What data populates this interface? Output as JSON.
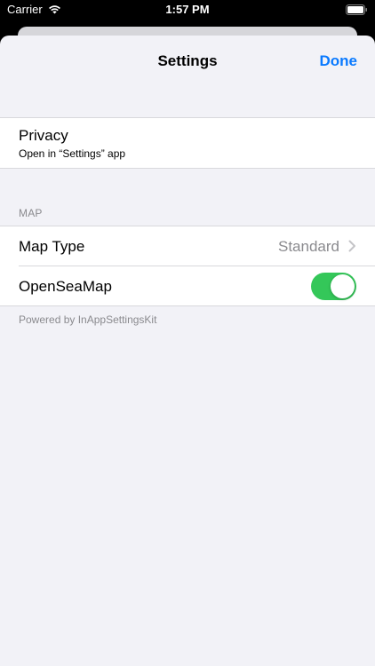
{
  "status_bar": {
    "carrier": "Carrier",
    "time": "1:57 PM",
    "wifi_icon": "wifi-icon",
    "battery_icon": "battery-icon"
  },
  "nav": {
    "title": "Settings",
    "done_label": "Done"
  },
  "privacy": {
    "title": "Privacy",
    "subtitle": "Open in “Settings” app"
  },
  "map_section": {
    "header": "MAP",
    "map_type": {
      "label": "Map Type",
      "value": "Standard",
      "icon": "chevron-right-icon"
    },
    "openseamap": {
      "label": "OpenSeaMap",
      "enabled": true
    }
  },
  "footer": {
    "text": "Powered by InAppSettingsKit"
  },
  "colors": {
    "accent": "#0a7aff",
    "toggle_on": "#34c759",
    "background": "#f2f2f7",
    "secondary_text": "#8a8a8e"
  }
}
